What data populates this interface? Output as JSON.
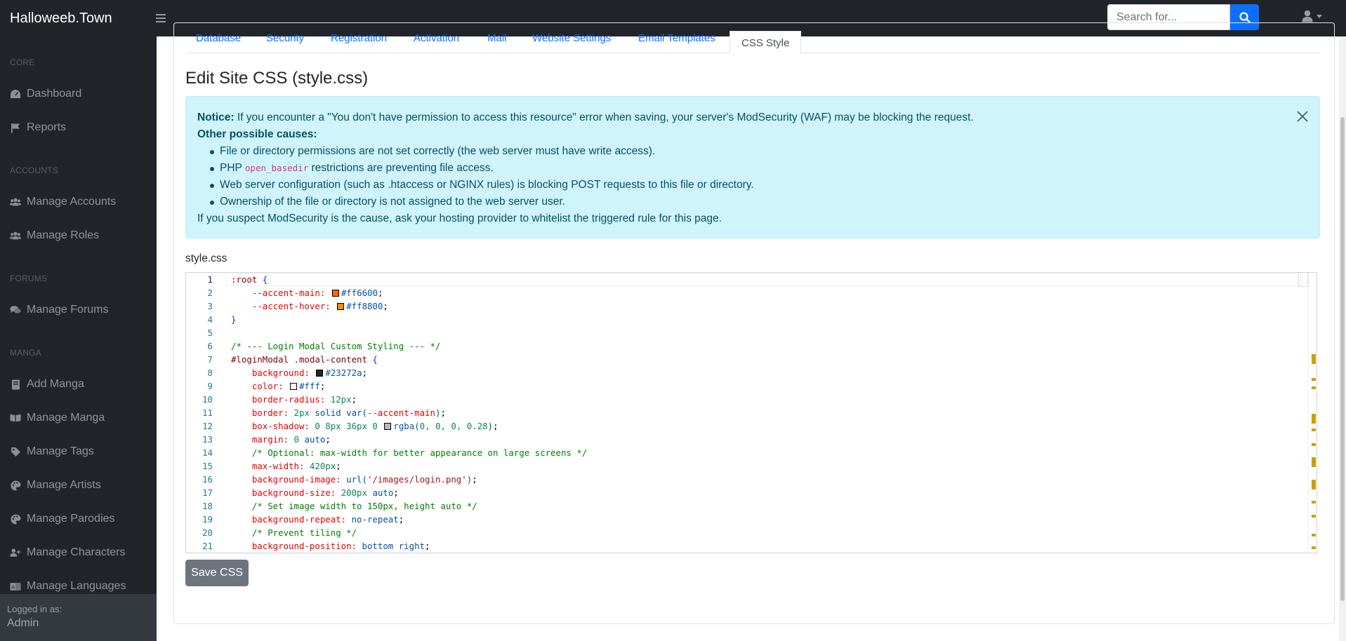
{
  "navbar": {
    "brand": "Halloweeb.Town",
    "search_placeholder": "Search for..."
  },
  "sidebar": {
    "sections": [
      {
        "heading": "CORE",
        "items": [
          {
            "label": "Dashboard",
            "icon": "tachometer-icon"
          },
          {
            "label": "Reports",
            "icon": "flag-icon"
          }
        ]
      },
      {
        "heading": "ACCOUNTS",
        "items": [
          {
            "label": "Manage Accounts",
            "icon": "users-icon"
          },
          {
            "label": "Manage Roles",
            "icon": "users-icon"
          }
        ]
      },
      {
        "heading": "FORUMS",
        "items": [
          {
            "label": "Manage Forums",
            "icon": "comments-icon"
          }
        ]
      },
      {
        "heading": "MANGA",
        "items": [
          {
            "label": "Add Manga",
            "icon": "book-icon"
          },
          {
            "label": "Manage Manga",
            "icon": "book-open-icon"
          },
          {
            "label": "Manage Tags",
            "icon": "tag-icon"
          },
          {
            "label": "Manage Artists",
            "icon": "palette-icon"
          },
          {
            "label": "Manage Parodies",
            "icon": "palette-icon"
          },
          {
            "label": "Manage Characters",
            "icon": "user-plus-icon"
          },
          {
            "label": "Manage Languages",
            "icon": "language-icon"
          }
        ]
      }
    ],
    "footer": {
      "logged_in_label": "Logged in as:",
      "username": "Admin"
    }
  },
  "tabs": [
    "Database",
    "Security",
    "Registration",
    "Activation",
    "Mail",
    "Website Settings",
    "Email Templates",
    "CSS Style"
  ],
  "active_tab": "CSS Style",
  "page_title": "Edit Site CSS (style.css)",
  "alert": {
    "notice_label": "Notice:",
    "notice_text": "If you encounter a \"You don't have permission to access this resource\" error when saving, your server's ModSecurity (WAF) may be blocking the request.",
    "causes_label": "Other possible causes:",
    "causes": [
      {
        "text": "File or directory permissions are not set correctly (the web server must have write access)."
      },
      {
        "pre": "PHP ",
        "code": "open_basedir",
        "post": " restrictions are preventing file access."
      },
      {
        "text": "Web server configuration (such as .htaccess or NGINX rules) is blocking POST requests to this file or directory."
      },
      {
        "text": "Ownership of the file or directory is not assigned to the web server user."
      }
    ],
    "footer": "If you suspect ModSecurity is the cause, ask your hosting provider to whitelist the triggered rule for this page."
  },
  "editor": {
    "file_label": "style.css",
    "current_line": 1,
    "lines": [
      [
        {
          "t": "sel",
          "v": ":root "
        },
        {
          "t": "brace",
          "v": "{"
        }
      ],
      [
        {
          "t": "",
          "v": "    "
        },
        {
          "t": "prop",
          "v": "--accent-main: "
        },
        {
          "t": "swatch",
          "v": "#ff6600"
        },
        {
          "t": "val",
          "v": "#ff6600"
        },
        {
          "t": "",
          "v": ";"
        }
      ],
      [
        {
          "t": "",
          "v": "    "
        },
        {
          "t": "prop",
          "v": "--accent-hover: "
        },
        {
          "t": "swatch",
          "v": "#ff8800"
        },
        {
          "t": "val",
          "v": "#ff8800"
        },
        {
          "t": "",
          "v": ";"
        }
      ],
      [
        {
          "t": "brace",
          "v": "}"
        }
      ],
      [],
      [
        {
          "t": "cmt",
          "v": "/* --- Login Modal Custom Styling --- */"
        }
      ],
      [
        {
          "t": "sel",
          "v": "#loginModal .modal-content "
        },
        {
          "t": "brace",
          "v": "{"
        }
      ],
      [
        {
          "t": "",
          "v": "    "
        },
        {
          "t": "prop",
          "v": "background: "
        },
        {
          "t": "swatch",
          "v": "#23272a"
        },
        {
          "t": "val",
          "v": "#23272a"
        },
        {
          "t": "",
          "v": ";"
        }
      ],
      [
        {
          "t": "",
          "v": "    "
        },
        {
          "t": "prop",
          "v": "color: "
        },
        {
          "t": "swatch",
          "v": "#fff"
        },
        {
          "t": "val",
          "v": "#fff"
        },
        {
          "t": "",
          "v": ";"
        }
      ],
      [
        {
          "t": "",
          "v": "    "
        },
        {
          "t": "prop",
          "v": "border-radius: "
        },
        {
          "t": "num",
          "v": "12px"
        },
        {
          "t": "",
          "v": ";"
        }
      ],
      [
        {
          "t": "",
          "v": "    "
        },
        {
          "t": "prop",
          "v": "border: "
        },
        {
          "t": "num",
          "v": "2px"
        },
        {
          "t": "val",
          "v": " solid var("
        },
        {
          "t": "prop",
          "v": "--accent-main"
        },
        {
          "t": "val",
          "v": ")"
        },
        {
          "t": "",
          "v": ";"
        }
      ],
      [
        {
          "t": "",
          "v": "    "
        },
        {
          "t": "prop",
          "v": "box-shadow: "
        },
        {
          "t": "num",
          "v": "0 8px 36px 0 "
        },
        {
          "t": "swatch",
          "v": "#b8b8b8"
        },
        {
          "t": "val",
          "v": "rgba("
        },
        {
          "t": "num",
          "v": "0, 0, 0, 0.28"
        },
        {
          "t": "val",
          "v": ")"
        },
        {
          "t": "",
          "v": ";"
        }
      ],
      [
        {
          "t": "",
          "v": "    "
        },
        {
          "t": "prop",
          "v": "margin: "
        },
        {
          "t": "num",
          "v": "0"
        },
        {
          "t": "val",
          "v": " auto"
        },
        {
          "t": "",
          "v": ";"
        }
      ],
      [
        {
          "t": "",
          "v": "    "
        },
        {
          "t": "cmt",
          "v": "/* Optional: max-width for better appearance on large screens */"
        }
      ],
      [
        {
          "t": "",
          "v": "    "
        },
        {
          "t": "prop",
          "v": "max-width: "
        },
        {
          "t": "num",
          "v": "420px"
        },
        {
          "t": "",
          "v": ";"
        }
      ],
      [
        {
          "t": "",
          "v": "    "
        },
        {
          "t": "prop",
          "v": "background-image: "
        },
        {
          "t": "val",
          "v": "url("
        },
        {
          "t": "str",
          "v": "'/images/login.png'"
        },
        {
          "t": "val",
          "v": ")"
        },
        {
          "t": "",
          "v": ";"
        }
      ],
      [
        {
          "t": "",
          "v": "    "
        },
        {
          "t": "prop",
          "v": "background-size: "
        },
        {
          "t": "num",
          "v": "200px"
        },
        {
          "t": "val",
          "v": " auto"
        },
        {
          "t": "",
          "v": ";"
        }
      ],
      [
        {
          "t": "",
          "v": "    "
        },
        {
          "t": "cmt",
          "v": "/* Set image width to 150px, height auto */"
        }
      ],
      [
        {
          "t": "",
          "v": "    "
        },
        {
          "t": "prop",
          "v": "background-repeat: "
        },
        {
          "t": "val",
          "v": "no-repeat"
        },
        {
          "t": "",
          "v": ";"
        }
      ],
      [
        {
          "t": "",
          "v": "    "
        },
        {
          "t": "cmt",
          "v": "/* Prevent tiling */"
        }
      ],
      [
        {
          "t": "",
          "v": "    "
        },
        {
          "t": "prop",
          "v": "background-position: "
        },
        {
          "t": "val",
          "v": "bottom right"
        },
        {
          "t": "",
          "v": ";"
        }
      ]
    ]
  },
  "save_button": "Save CSS"
}
